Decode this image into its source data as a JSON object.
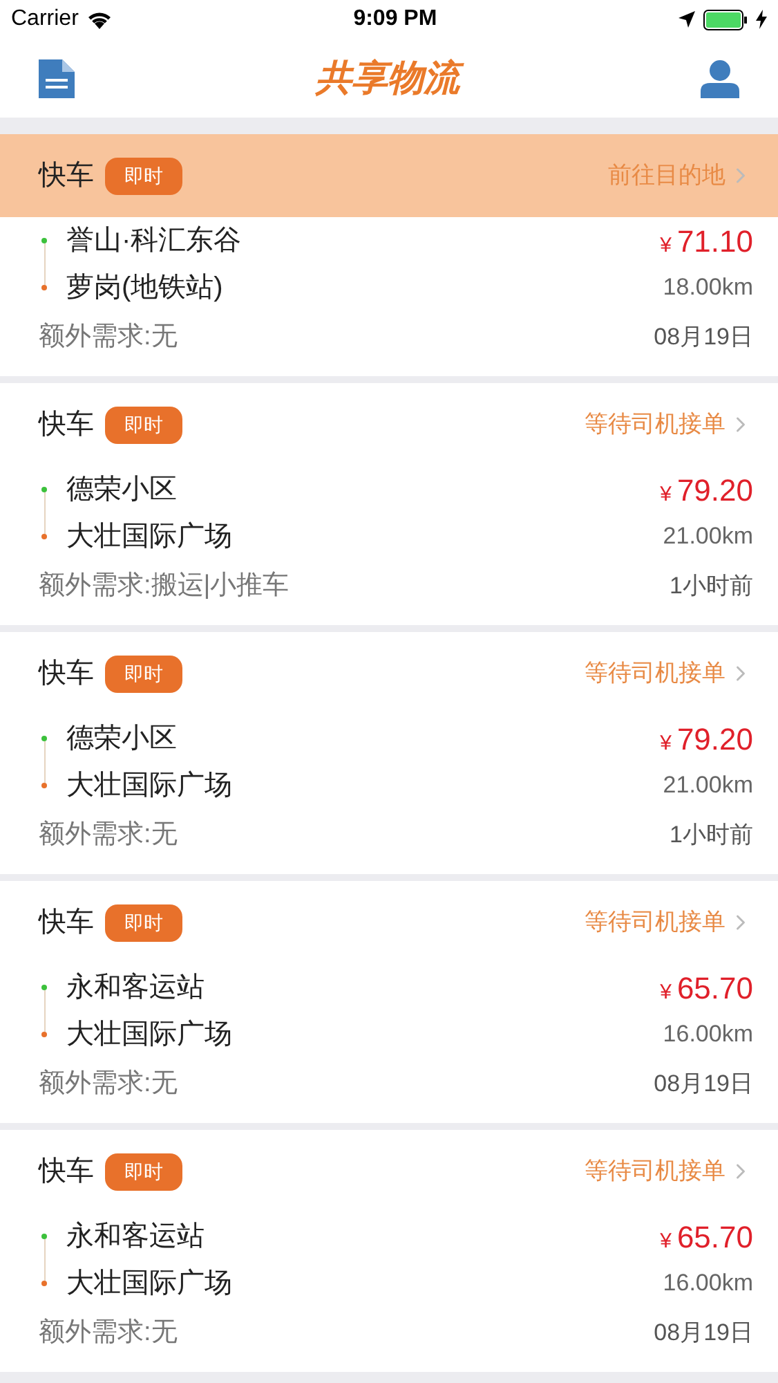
{
  "status_bar": {
    "carrier": "Carrier",
    "time": "9:09 PM"
  },
  "nav": {
    "title": "共享物流"
  },
  "orders": [
    {
      "type": "快车",
      "tag": "即时",
      "status": "前往目的地",
      "selected": true,
      "from": "誉山·科汇东谷",
      "to": "萝岗(地铁站)",
      "currency": "¥",
      "price": "71.10",
      "distance": "18.00km",
      "extra": "额外需求:无",
      "time": "08月19日"
    },
    {
      "type": "快车",
      "tag": "即时",
      "status": "等待司机接单",
      "selected": false,
      "from": "德荣小区",
      "to": "大壮国际广场",
      "currency": "¥",
      "price": "79.20",
      "distance": "21.00km",
      "extra": "额外需求:搬运|小推车",
      "time": "1小时前"
    },
    {
      "type": "快车",
      "tag": "即时",
      "status": "等待司机接单",
      "selected": false,
      "from": "德荣小区",
      "to": "大壮国际广场",
      "currency": "¥",
      "price": "79.20",
      "distance": "21.00km",
      "extra": "额外需求:无",
      "time": "1小时前"
    },
    {
      "type": "快车",
      "tag": "即时",
      "status": "等待司机接单",
      "selected": false,
      "from": "永和客运站",
      "to": "大壮国际广场",
      "currency": "¥",
      "price": "65.70",
      "distance": "16.00km",
      "extra": "额外需求:无",
      "time": "08月19日"
    },
    {
      "type": "快车",
      "tag": "即时",
      "status": "等待司机接单",
      "selected": false,
      "from": "永和客运站",
      "to": "大壮国际广场",
      "currency": "¥",
      "price": "65.70",
      "distance": "16.00km",
      "extra": "额外需求:无",
      "time": "08月19日"
    }
  ]
}
